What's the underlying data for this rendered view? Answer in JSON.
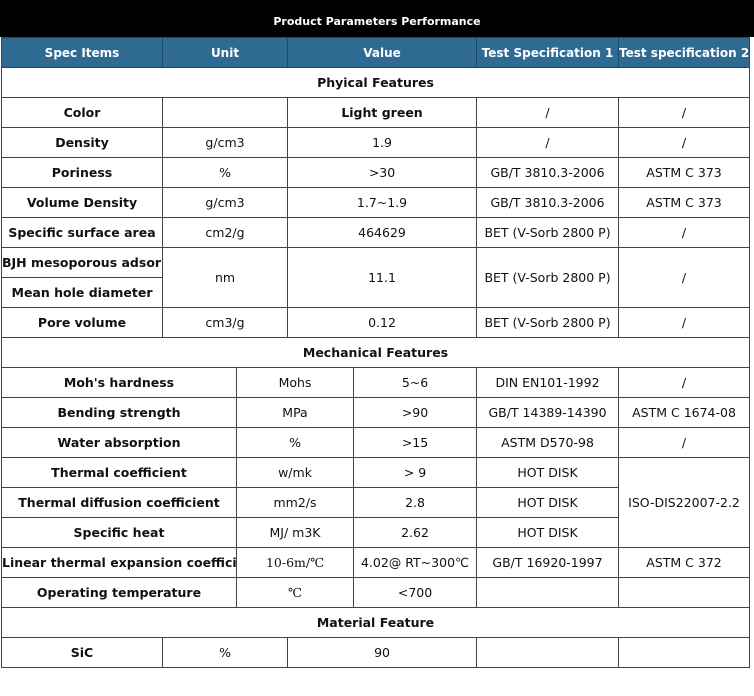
{
  "title": "Product Parameters Performance",
  "header": [
    "Spec Items",
    "Unit",
    "Value",
    "Test Specification 1",
    "Test specification 2"
  ],
  "colors": {
    "header_bg": "#2f6a93",
    "title_bg": "#000000",
    "border": "#444444"
  },
  "sections": {
    "physical": {
      "label": "Phyical Features",
      "rows": [
        {
          "item": "Color",
          "unit": "",
          "value": "Light green",
          "spec1": "/",
          "spec2": "/"
        },
        {
          "item": "Density",
          "unit": "g/cm3",
          "value": "1.9",
          "spec1": "/",
          "spec2": "/"
        },
        {
          "item": "Poriness",
          "unit": "%",
          "value": ">30",
          "spec1": "GB/T 3810.3-2006",
          "spec2": "ASTM C 373"
        },
        {
          "item": "Volume Density",
          "unit": "g/cm3",
          "value": "1.7~1.9",
          "spec1": "GB/T 3810.3-2006",
          "spec2": "ASTM C 373"
        },
        {
          "item": "Specific surface area",
          "unit": "cm2/g",
          "value": "464629",
          "spec1": "BET (V-Sorb 2800 P)",
          "spec2": "/"
        },
        {
          "item": "BJH mesoporous adsorption",
          "item2": "Mean hole diameter",
          "unit": "nm",
          "value": "11.1",
          "spec1": "BET (V-Sorb 2800 P)",
          "spec2": "/"
        },
        {
          "item": "Pore volume",
          "unit": "cm3/g",
          "value": "0.12",
          "spec1": "BET (V-Sorb 2800 P)",
          "spec2": "/"
        }
      ]
    },
    "mechanical": {
      "label": "Mechanical Features",
      "rows": [
        {
          "item": "Moh's hardness",
          "unit": "Mohs",
          "value": "5~6",
          "spec1": "DIN EN101-1992",
          "spec2": "/"
        },
        {
          "item": "Bending strength",
          "unit": "MPa",
          "value": ">90",
          "spec1": "GB/T 14389-14390",
          "spec2": "ASTM C 1674-08"
        },
        {
          "item": "Water absorption",
          "unit": "%",
          "value": ">15",
          "spec1": "ASTM D570-98",
          "spec2": "/"
        },
        {
          "item": "Thermal coefficient",
          "unit": "w/mk",
          "value": "> 9",
          "spec1": "HOT DISK",
          "spec2": "ISO-DIS22007-2.2"
        },
        {
          "item": "Thermal diffusion coefficient",
          "unit": "mm2/s",
          "value": "2.8",
          "spec1": "HOT DISK"
        },
        {
          "item": "Specific heat",
          "unit": "MJ/ m3K",
          "value": "2.62",
          "spec1": "HOT DISK"
        },
        {
          "item": "Linear thermal expansion coefficient",
          "unit": "10-6m/℃",
          "value": "4.02@ RT~300℃",
          "spec1": "GB/T 16920-1997",
          "spec2": "ASTM C 372"
        },
        {
          "item": "Operating temperature",
          "unit": "℃",
          "value": "<700",
          "spec1": "",
          "spec2": ""
        }
      ]
    },
    "material": {
      "label": "Material Feature",
      "rows": [
        {
          "item": "SiC",
          "unit": "%",
          "value": "90",
          "spec1": "",
          "spec2": ""
        }
      ]
    }
  }
}
